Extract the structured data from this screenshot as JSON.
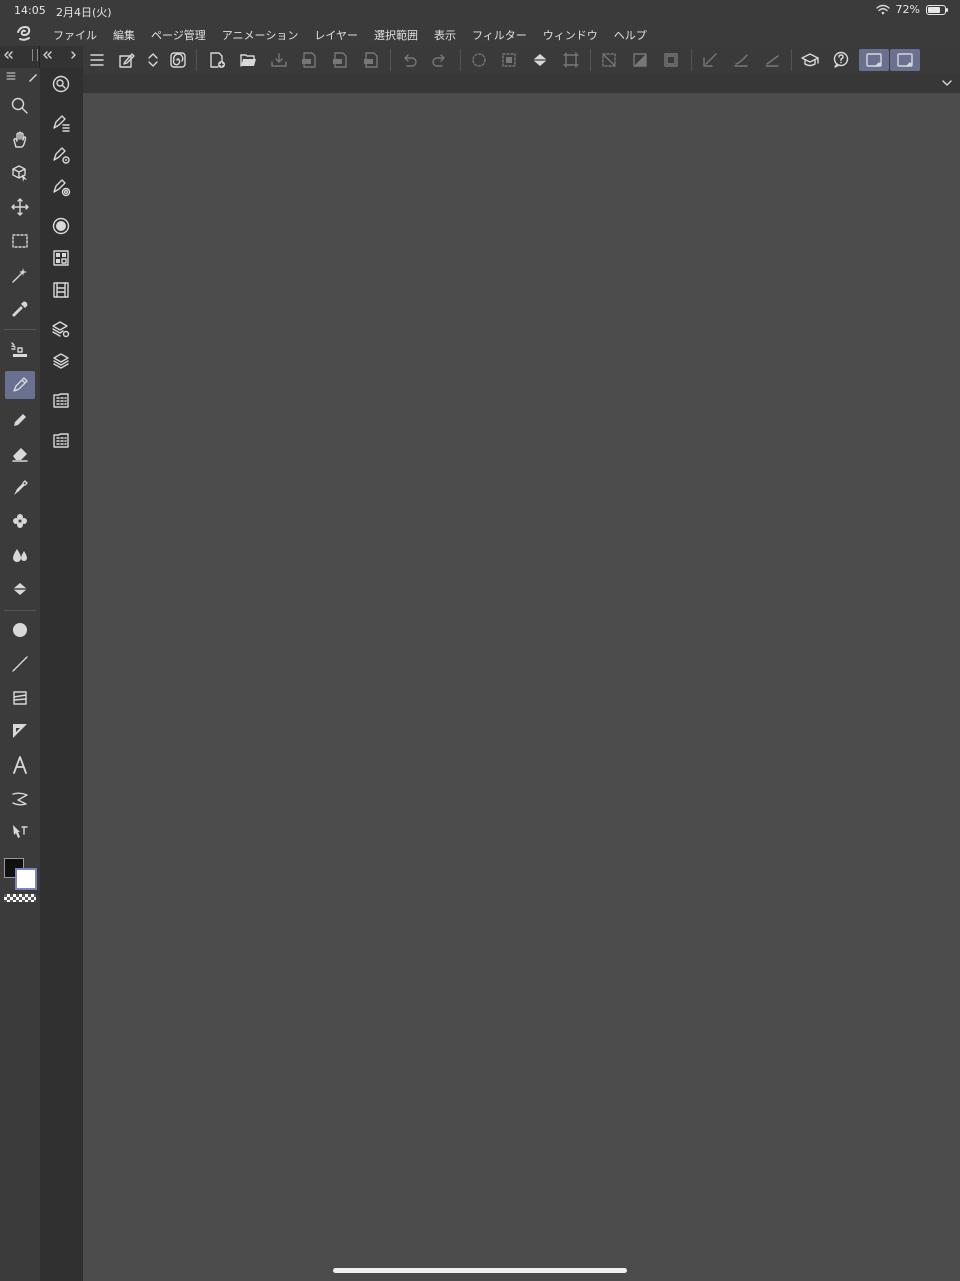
{
  "status_bar": {
    "time": "14:05",
    "date": "2月4日(火)",
    "battery": "72%",
    "battery_level": 0.72
  },
  "menu": {
    "items": [
      "ファイル",
      "編集",
      "ページ管理",
      "アニメーション",
      "レイヤー",
      "選択範囲",
      "表示",
      "フィルター",
      "ウィンドウ",
      "ヘルプ"
    ]
  },
  "toolbox": {
    "active_tool": "pen-tool",
    "main_color": "#111111",
    "sub_color": "#ffffff",
    "accent": "#6a7190"
  },
  "toolbar": {
    "active_buttons": [
      "left-panel-toggle",
      "right-panel-toggle"
    ]
  }
}
